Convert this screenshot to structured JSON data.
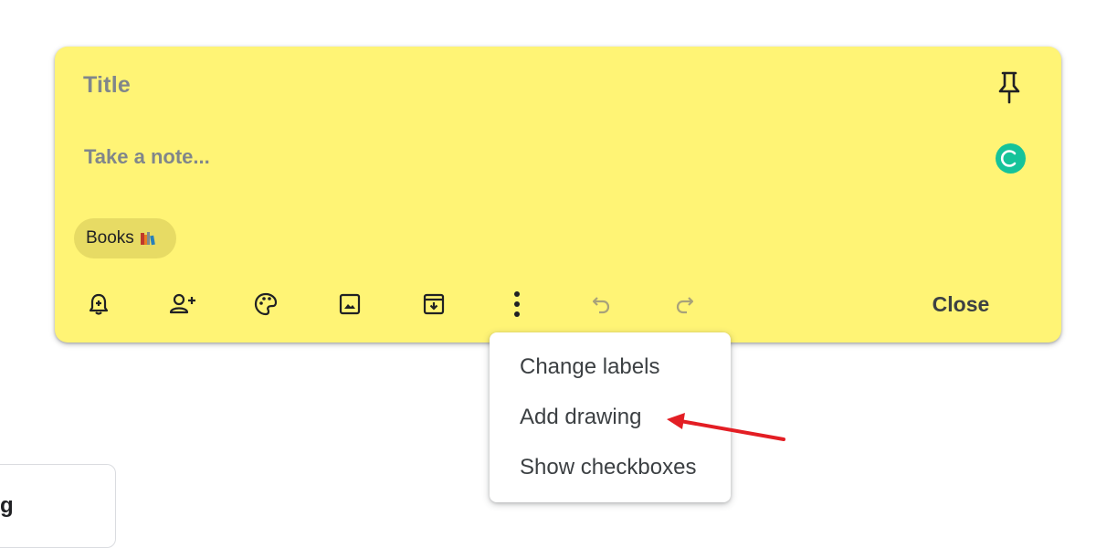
{
  "note": {
    "title_placeholder": "Title",
    "body_placeholder": "Take a note...",
    "background_color": "#fff475",
    "label_chip": "Books",
    "close_label": "Close"
  },
  "toolbar": {
    "icons": [
      "remind-me-icon",
      "collaborator-icon",
      "palette-icon",
      "image-icon",
      "archive-icon",
      "more-options-icon",
      "undo-icon",
      "redo-icon"
    ]
  },
  "more_menu": {
    "items": [
      "Change labels",
      "Add drawing",
      "Show checkboxes"
    ]
  },
  "annotation": {
    "arrow_color": "#e31e24"
  },
  "background_card": {
    "text": "g"
  }
}
